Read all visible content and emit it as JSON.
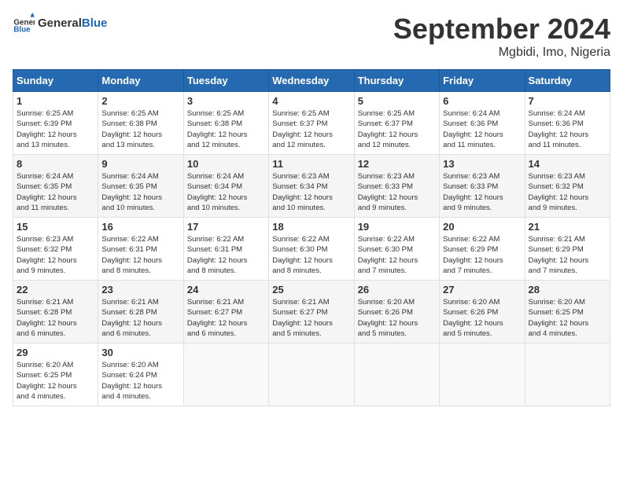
{
  "header": {
    "logo_general": "General",
    "logo_blue": "Blue",
    "month_year": "September 2024",
    "location": "Mgbidi, Imo, Nigeria"
  },
  "days_of_week": [
    "Sunday",
    "Monday",
    "Tuesday",
    "Wednesday",
    "Thursday",
    "Friday",
    "Saturday"
  ],
  "weeks": [
    [
      {
        "day": "1",
        "info": "Sunrise: 6:25 AM\nSunset: 6:39 PM\nDaylight: 12 hours\nand 13 minutes."
      },
      {
        "day": "2",
        "info": "Sunrise: 6:25 AM\nSunset: 6:38 PM\nDaylight: 12 hours\nand 13 minutes."
      },
      {
        "day": "3",
        "info": "Sunrise: 6:25 AM\nSunset: 6:38 PM\nDaylight: 12 hours\nand 12 minutes."
      },
      {
        "day": "4",
        "info": "Sunrise: 6:25 AM\nSunset: 6:37 PM\nDaylight: 12 hours\nand 12 minutes."
      },
      {
        "day": "5",
        "info": "Sunrise: 6:25 AM\nSunset: 6:37 PM\nDaylight: 12 hours\nand 12 minutes."
      },
      {
        "day": "6",
        "info": "Sunrise: 6:24 AM\nSunset: 6:36 PM\nDaylight: 12 hours\nand 11 minutes."
      },
      {
        "day": "7",
        "info": "Sunrise: 6:24 AM\nSunset: 6:36 PM\nDaylight: 12 hours\nand 11 minutes."
      }
    ],
    [
      {
        "day": "8",
        "info": "Sunrise: 6:24 AM\nSunset: 6:35 PM\nDaylight: 12 hours\nand 11 minutes."
      },
      {
        "day": "9",
        "info": "Sunrise: 6:24 AM\nSunset: 6:35 PM\nDaylight: 12 hours\nand 10 minutes."
      },
      {
        "day": "10",
        "info": "Sunrise: 6:24 AM\nSunset: 6:34 PM\nDaylight: 12 hours\nand 10 minutes."
      },
      {
        "day": "11",
        "info": "Sunrise: 6:23 AM\nSunset: 6:34 PM\nDaylight: 12 hours\nand 10 minutes."
      },
      {
        "day": "12",
        "info": "Sunrise: 6:23 AM\nSunset: 6:33 PM\nDaylight: 12 hours\nand 9 minutes."
      },
      {
        "day": "13",
        "info": "Sunrise: 6:23 AM\nSunset: 6:33 PM\nDaylight: 12 hours\nand 9 minutes."
      },
      {
        "day": "14",
        "info": "Sunrise: 6:23 AM\nSunset: 6:32 PM\nDaylight: 12 hours\nand 9 minutes."
      }
    ],
    [
      {
        "day": "15",
        "info": "Sunrise: 6:23 AM\nSunset: 6:32 PM\nDaylight: 12 hours\nand 9 minutes."
      },
      {
        "day": "16",
        "info": "Sunrise: 6:22 AM\nSunset: 6:31 PM\nDaylight: 12 hours\nand 8 minutes."
      },
      {
        "day": "17",
        "info": "Sunrise: 6:22 AM\nSunset: 6:31 PM\nDaylight: 12 hours\nand 8 minutes."
      },
      {
        "day": "18",
        "info": "Sunrise: 6:22 AM\nSunset: 6:30 PM\nDaylight: 12 hours\nand 8 minutes."
      },
      {
        "day": "19",
        "info": "Sunrise: 6:22 AM\nSunset: 6:30 PM\nDaylight: 12 hours\nand 7 minutes."
      },
      {
        "day": "20",
        "info": "Sunrise: 6:22 AM\nSunset: 6:29 PM\nDaylight: 12 hours\nand 7 minutes."
      },
      {
        "day": "21",
        "info": "Sunrise: 6:21 AM\nSunset: 6:29 PM\nDaylight: 12 hours\nand 7 minutes."
      }
    ],
    [
      {
        "day": "22",
        "info": "Sunrise: 6:21 AM\nSunset: 6:28 PM\nDaylight: 12 hours\nand 6 minutes."
      },
      {
        "day": "23",
        "info": "Sunrise: 6:21 AM\nSunset: 6:28 PM\nDaylight: 12 hours\nand 6 minutes."
      },
      {
        "day": "24",
        "info": "Sunrise: 6:21 AM\nSunset: 6:27 PM\nDaylight: 12 hours\nand 6 minutes."
      },
      {
        "day": "25",
        "info": "Sunrise: 6:21 AM\nSunset: 6:27 PM\nDaylight: 12 hours\nand 5 minutes."
      },
      {
        "day": "26",
        "info": "Sunrise: 6:20 AM\nSunset: 6:26 PM\nDaylight: 12 hours\nand 5 minutes."
      },
      {
        "day": "27",
        "info": "Sunrise: 6:20 AM\nSunset: 6:26 PM\nDaylight: 12 hours\nand 5 minutes."
      },
      {
        "day": "28",
        "info": "Sunrise: 6:20 AM\nSunset: 6:25 PM\nDaylight: 12 hours\nand 4 minutes."
      }
    ],
    [
      {
        "day": "29",
        "info": "Sunrise: 6:20 AM\nSunset: 6:25 PM\nDaylight: 12 hours\nand 4 minutes."
      },
      {
        "day": "30",
        "info": "Sunrise: 6:20 AM\nSunset: 6:24 PM\nDaylight: 12 hours\nand 4 minutes."
      },
      {
        "day": "",
        "info": ""
      },
      {
        "day": "",
        "info": ""
      },
      {
        "day": "",
        "info": ""
      },
      {
        "day": "",
        "info": ""
      },
      {
        "day": "",
        "info": ""
      }
    ]
  ]
}
